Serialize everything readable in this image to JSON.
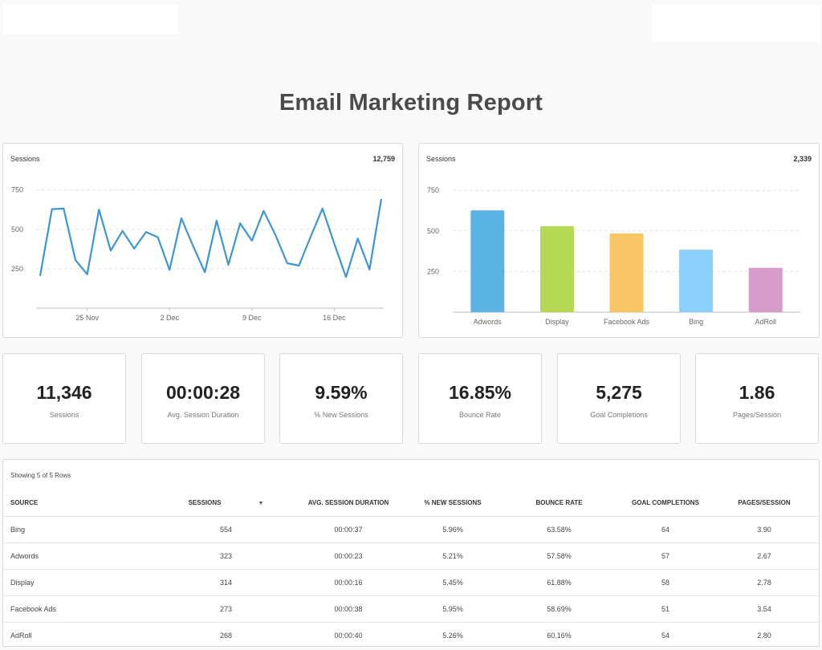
{
  "report": {
    "title": "Email Marketing Report"
  },
  "line_card": {
    "label": "Sessions",
    "total": "12,759"
  },
  "bar_card": {
    "label": "Sessions",
    "total": "2,339"
  },
  "chart_data": [
    {
      "type": "line",
      "title": "Sessions",
      "total": "12,759",
      "x_tick_labels": [
        "25 Nov",
        "2 Dec",
        "9 Dec",
        "16 Dec"
      ],
      "y_tick_labels": [
        "250",
        "500",
        "750"
      ],
      "ylim": [
        0,
        840
      ],
      "grid": true,
      "color": "#3d95d2",
      "values": [
        205,
        628,
        632,
        305,
        215,
        625,
        365,
        490,
        378,
        483,
        450,
        243,
        570,
        395,
        228,
        555,
        275,
        538,
        428,
        617,
        465,
        285,
        270,
        455,
        632,
        410,
        197,
        442,
        245,
        693
      ]
    },
    {
      "type": "bar",
      "title": "Sessions",
      "total": "2,339",
      "categories": [
        "Adwords",
        "Display",
        "Facebook Ads",
        "Bing",
        "AdRoll"
      ],
      "values": [
        627,
        530,
        485,
        385,
        273
      ],
      "colors": [
        "#5bb3e3",
        "#b5d955",
        "#f8c565",
        "#8ad0fb",
        "#d89ccb"
      ],
      "y_tick_labels": [
        "250",
        "500",
        "750"
      ],
      "ylim": [
        0,
        840
      ],
      "grid": true
    }
  ],
  "kpis": [
    {
      "value": "11,346",
      "label": "Sessions"
    },
    {
      "value": "00:00:28",
      "label": "Avg. Session Duration"
    },
    {
      "value": "9.59%",
      "label": "% New Sessions"
    },
    {
      "value": "16.85%",
      "label": "Bounce Rate"
    },
    {
      "value": "5,275",
      "label": "Goal Completions"
    },
    {
      "value": "1.86",
      "label": "Pages/Session"
    }
  ],
  "table": {
    "info": "Showing 5 of 5 Rows",
    "sort_icon": "caret-down-icon",
    "headers": [
      "Source",
      "Sessions",
      "Avg. Session Duration",
      "% New Sessions",
      "Bounce Rate",
      "Goal Completions",
      "Pages/Session"
    ],
    "rows": [
      [
        "Bing",
        "554",
        "00:00:37",
        "5.96%",
        "63.58%",
        "64",
        "3.90"
      ],
      [
        "Adwords",
        "323",
        "00:00:23",
        "5.21%",
        "57.58%",
        "57",
        "2.67"
      ],
      [
        "Display",
        "314",
        "00:00:16",
        "5.45%",
        "61.88%",
        "58",
        "2.78"
      ],
      [
        "Facebook Ads",
        "273",
        "00:00:38",
        "5.95%",
        "58.69%",
        "51",
        "3.54"
      ],
      [
        "AdRoll",
        "268",
        "00:00:40",
        "5.26%",
        "60.16%",
        "54",
        "2.80"
      ]
    ]
  }
}
